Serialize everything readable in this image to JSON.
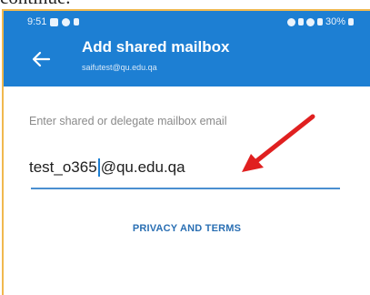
{
  "status_bar": {
    "time": "9:51",
    "battery": "30%"
  },
  "header": {
    "title": "Add shared mailbox",
    "subtitle": "saifutest@qu.edu.qa"
  },
  "form": {
    "label": "Enter shared or delegate mailbox email",
    "value_before_caret": "test_o365",
    "value_after_caret": "@qu.edu.qa"
  },
  "footer": {
    "privacy_link": "PRIVACY AND TERMS"
  },
  "colors": {
    "app_bar": "#1d7fd3",
    "accent_link": "#2a6fb3",
    "annotation_arrow": "#e02020",
    "frame_border": "#f0b84e"
  },
  "icons": [
    "back-arrow-icon",
    "annotation-arrow-icon"
  ]
}
